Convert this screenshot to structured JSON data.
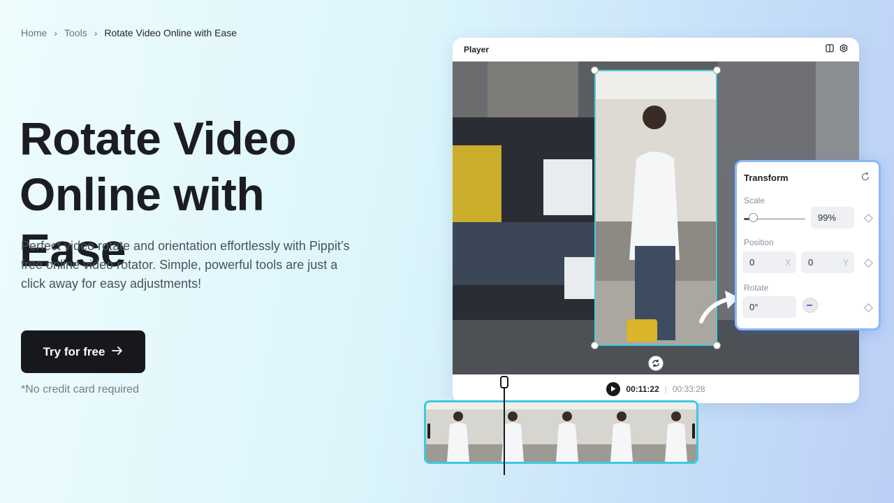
{
  "breadcrumb": {
    "home": "Home",
    "tools": "Tools",
    "current": "Rotate Video Online with Ease",
    "separator": "›"
  },
  "hero": {
    "title_line1": "Rotate Video",
    "title_line2": "Online with Ease",
    "description": "Perfect video rotate and orientation effortlessly with Pippit’s free online video rotator. Simple, powerful tools are just a click away for easy adjustments!",
    "cta_label": "Try for free",
    "cta_icon": "arrow-right-icon",
    "note": "*No credit card required"
  },
  "player": {
    "title": "Player",
    "icons": [
      "layout-icon",
      "settings-icon"
    ],
    "current_time": "00:11:22",
    "separator": "|",
    "total_time": "00:33:28"
  },
  "transform": {
    "title": "Transform",
    "scale_label": "Scale",
    "scale_value": "99%",
    "scale_fraction": 0.15,
    "position_label": "Position",
    "position_x": "0",
    "position_x_suffix": "X",
    "position_y": "0",
    "position_y_suffix": "Y",
    "rotate_label": "Rotate",
    "rotate_value": "0°"
  },
  "colors": {
    "accent": "#46cde0",
    "panel_border": "#8ab7f6",
    "cta_bg": "#17181c"
  }
}
